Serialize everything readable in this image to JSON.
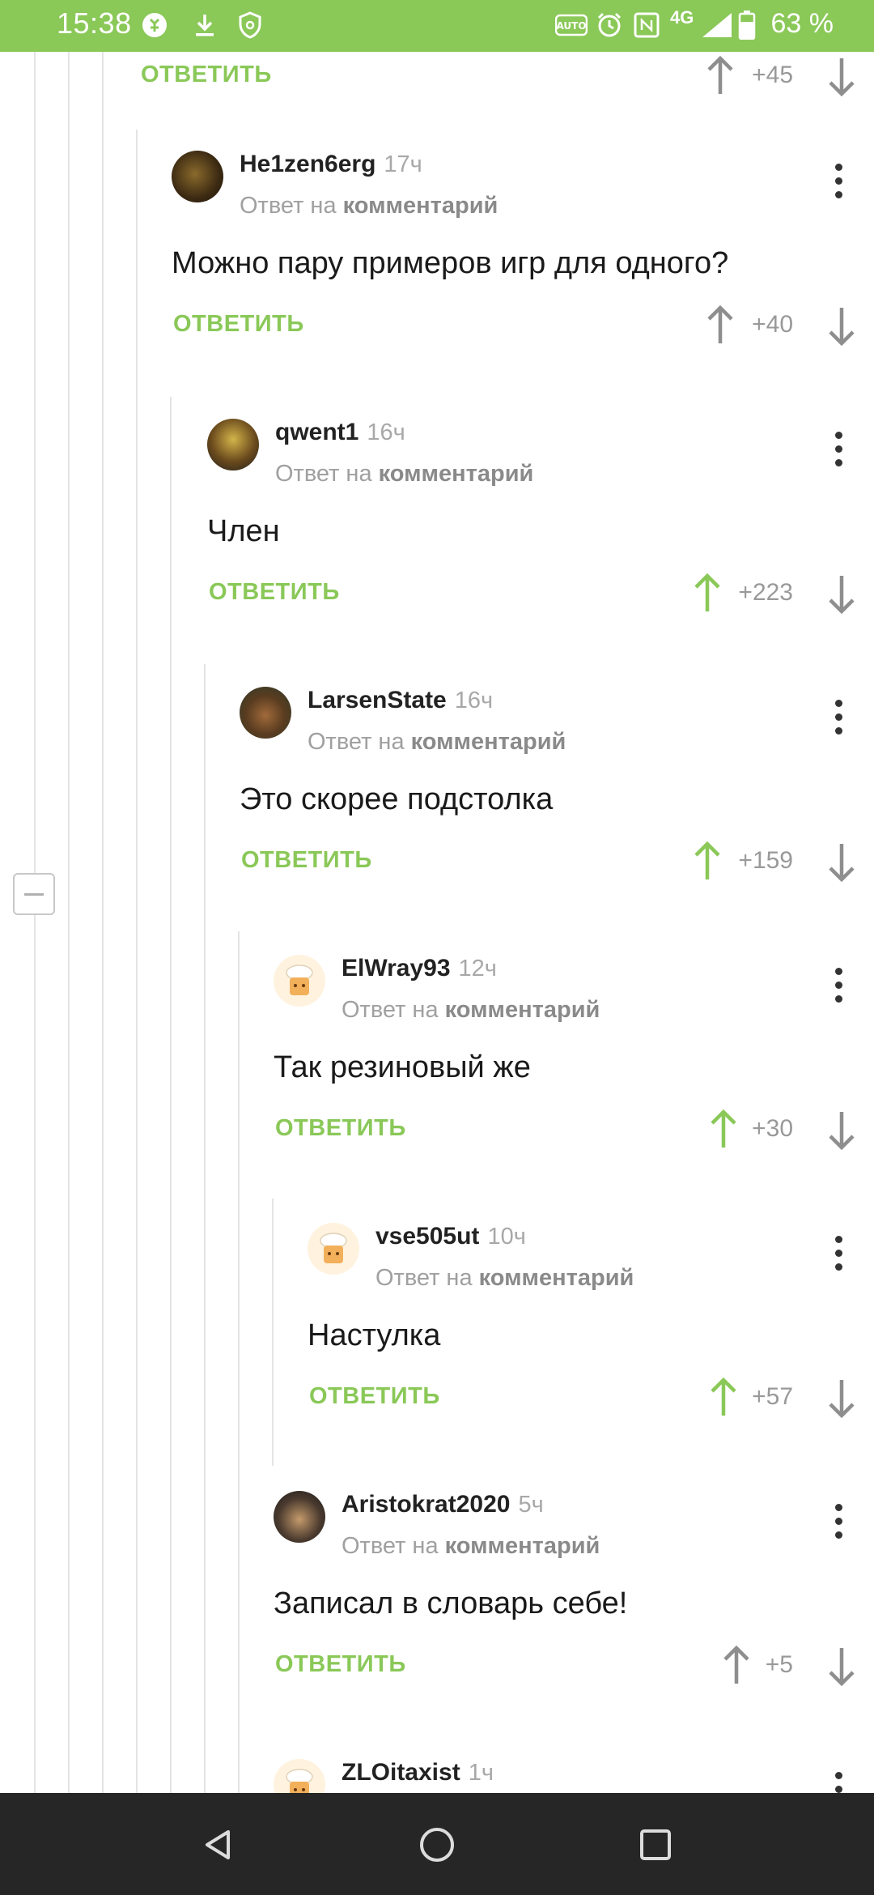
{
  "status_bar": {
    "time": "15:38",
    "network": "4G",
    "battery": "63 %",
    "icons": [
      "app-icon",
      "download-icon",
      "shield-icon",
      "auto-brightness-icon",
      "alarm-icon",
      "nfc-icon",
      "signal-icon",
      "battery-icon"
    ]
  },
  "colors": {
    "accent": "#8ac858",
    "status_bar": "#8ac858",
    "nav_bar": "#262626"
  },
  "top_partial": {
    "reply_label": "ОТВЕТИТЬ",
    "score": "+45"
  },
  "comments": [
    {
      "author": "He1zen6erg",
      "time": "17ч",
      "reply_prefix": "Ответ на",
      "reply_target": "комментарий",
      "text": "Можно пару примеров игр для одного?",
      "reply_label": "ОТВЕТИТЬ",
      "score": "+40",
      "upvoted": false
    },
    {
      "author": "qwent1",
      "time": "16ч",
      "reply_prefix": "Ответ на",
      "reply_target": "комментарий",
      "text": "Член",
      "reply_label": "ОТВЕТИТЬ",
      "score": "+223",
      "upvoted": true
    },
    {
      "author": "LarsenState",
      "time": "16ч",
      "reply_prefix": "Ответ на",
      "reply_target": "комментарий",
      "text": "Это скорее подстолка",
      "reply_label": "ОТВЕТИТЬ",
      "score": "+159",
      "upvoted": true
    },
    {
      "author": "ElWray93",
      "time": "12ч",
      "reply_prefix": "Ответ на",
      "reply_target": "комментарий",
      "text": "Так резиновый же",
      "reply_label": "ОТВЕТИТЬ",
      "score": "+30",
      "upvoted": true
    },
    {
      "author": "vse505ut",
      "time": "10ч",
      "reply_prefix": "Ответ на",
      "reply_target": "комментарий",
      "text": "Настулка",
      "reply_label": "ОТВЕТИТЬ",
      "score": "+57",
      "upvoted": true
    },
    {
      "author": "Aristokrat2020",
      "time": "5ч",
      "reply_prefix": "Ответ на",
      "reply_target": "комментарий",
      "text": "Записал в словарь себе!",
      "reply_label": "ОТВЕТИТЬ",
      "score": "+5",
      "upvoted": false
    },
    {
      "author": "ZLOitaxist",
      "time": "1ч"
    }
  ],
  "nav": {
    "buttons": [
      "back-icon",
      "home-icon",
      "recents-icon"
    ]
  }
}
